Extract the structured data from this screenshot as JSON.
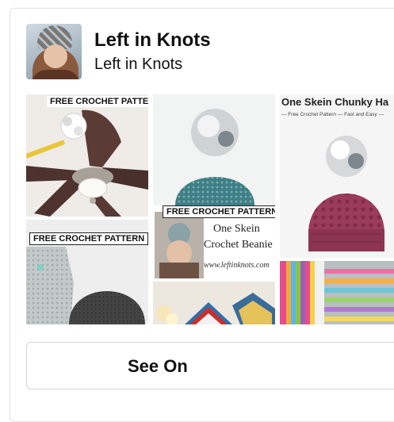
{
  "board": {
    "title": "Left in Knots",
    "owner": "Left in Knots"
  },
  "pins": [
    {
      "ribbon": "FREE CROCHET PATTERN",
      "icon": "ceiling-fan-photo"
    },
    {
      "ribbon": "FREE CROCHET PATTERN",
      "line1": "One Skein",
      "line2": "Crochet Beanie",
      "url": "www.leftinknots.com",
      "icon": "teal-beanie-photo"
    },
    {
      "title": "One Skein Chunky Ha",
      "tagline": "— Free Crochet Pattern — Fast and Easy —",
      "icon": "pink-beanie-photo"
    },
    {
      "ribbon": "FREE CROCHET PATTERN",
      "icon": "gray-mittens-photo"
    },
    {
      "icon": "chevron-blanket-photo"
    },
    {
      "icon": "striped-blanket-photo"
    }
  ],
  "action": {
    "label": "See On"
  },
  "colors": {
    "accent_pink": "#9c3b5c",
    "teal": "#3f7f86",
    "border": "#e3e3e3"
  }
}
